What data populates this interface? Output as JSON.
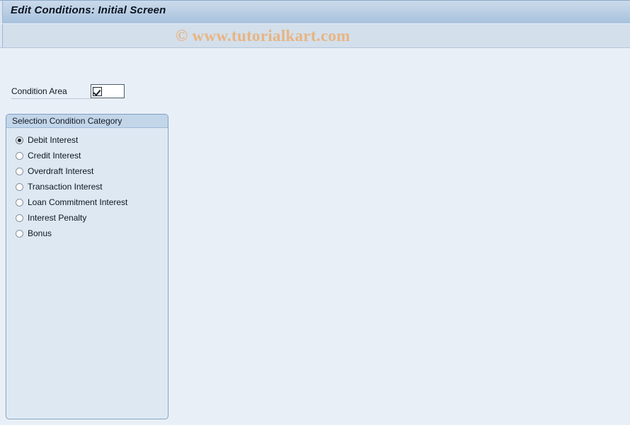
{
  "window": {
    "title": "Edit Conditions: Initial Screen"
  },
  "toolbar": {
    "watermark": "© www.tutorialkart.com"
  },
  "form": {
    "condition_area": {
      "label": "Condition Area",
      "value": "",
      "placeholder": "",
      "entry_icon": "checkbox-checked-icon"
    }
  },
  "group": {
    "title": "Selection Condition Category",
    "options": [
      {
        "label": "Debit Interest",
        "selected": true
      },
      {
        "label": "Credit Interest",
        "selected": false
      },
      {
        "label": "Overdraft Interest",
        "selected": false
      },
      {
        "label": "Transaction Interest",
        "selected": false
      },
      {
        "label": "Loan Commitment Interest",
        "selected": false
      },
      {
        "label": "Interest Penalty",
        "selected": false
      },
      {
        "label": "Bonus",
        "selected": false
      }
    ]
  },
  "colors": {
    "page_background": "#e9eff7",
    "titlebar_gradient_top": "#cbdaeb",
    "titlebar_gradient_bottom": "#a9c2dd",
    "toolbar_background": "#d3dfeb",
    "groupbox_background": "#dde8f2",
    "groupbox_header": "#c3d5e9",
    "groupbox_border": "#7d9fc4",
    "watermark_text": "#e8b481",
    "text_primary": "#101820"
  }
}
